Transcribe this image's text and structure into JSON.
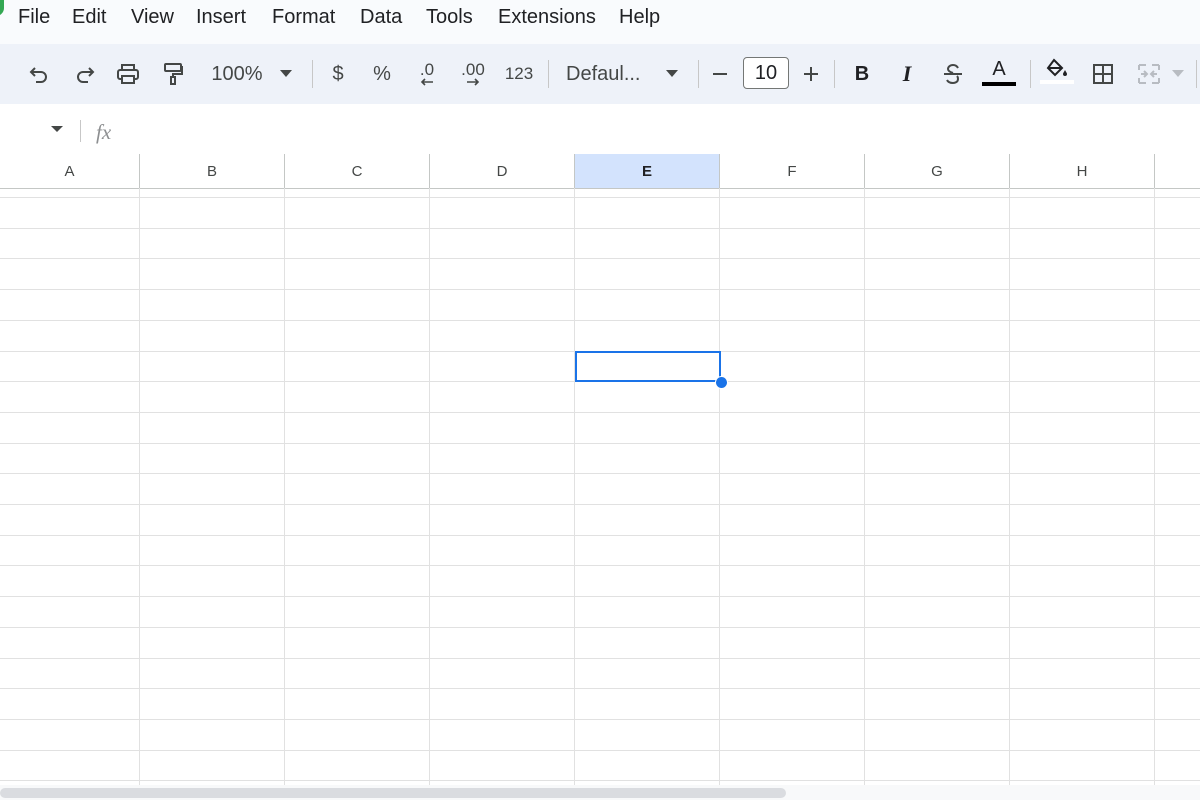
{
  "menubar": {
    "items": [
      "File",
      "Edit",
      "View",
      "Insert",
      "Format",
      "Data",
      "Tools",
      "Extensions",
      "Help"
    ]
  },
  "toolbar": {
    "zoom": "100%",
    "currency": "$",
    "percent": "%",
    "decrease_decimal": ".0",
    "increase_decimal": ".00",
    "number_format": "123",
    "font": "Defaul...",
    "font_size": "10",
    "bold": "B",
    "italic": "I",
    "text_color": "A",
    "icons": [
      "undo-icon",
      "redo-icon",
      "print-icon",
      "paint-format-icon",
      "strikethrough-icon",
      "fill-color-icon",
      "borders-icon",
      "merge-cells-icon"
    ]
  },
  "formula_bar": {
    "fx": "fx"
  },
  "grid": {
    "columns": [
      "A",
      "B",
      "C",
      "D",
      "E",
      "F",
      "G",
      "H"
    ],
    "selected_column": "E",
    "accent_color": "#1a73e8",
    "selected_header_color": "#d3e3fd"
  }
}
